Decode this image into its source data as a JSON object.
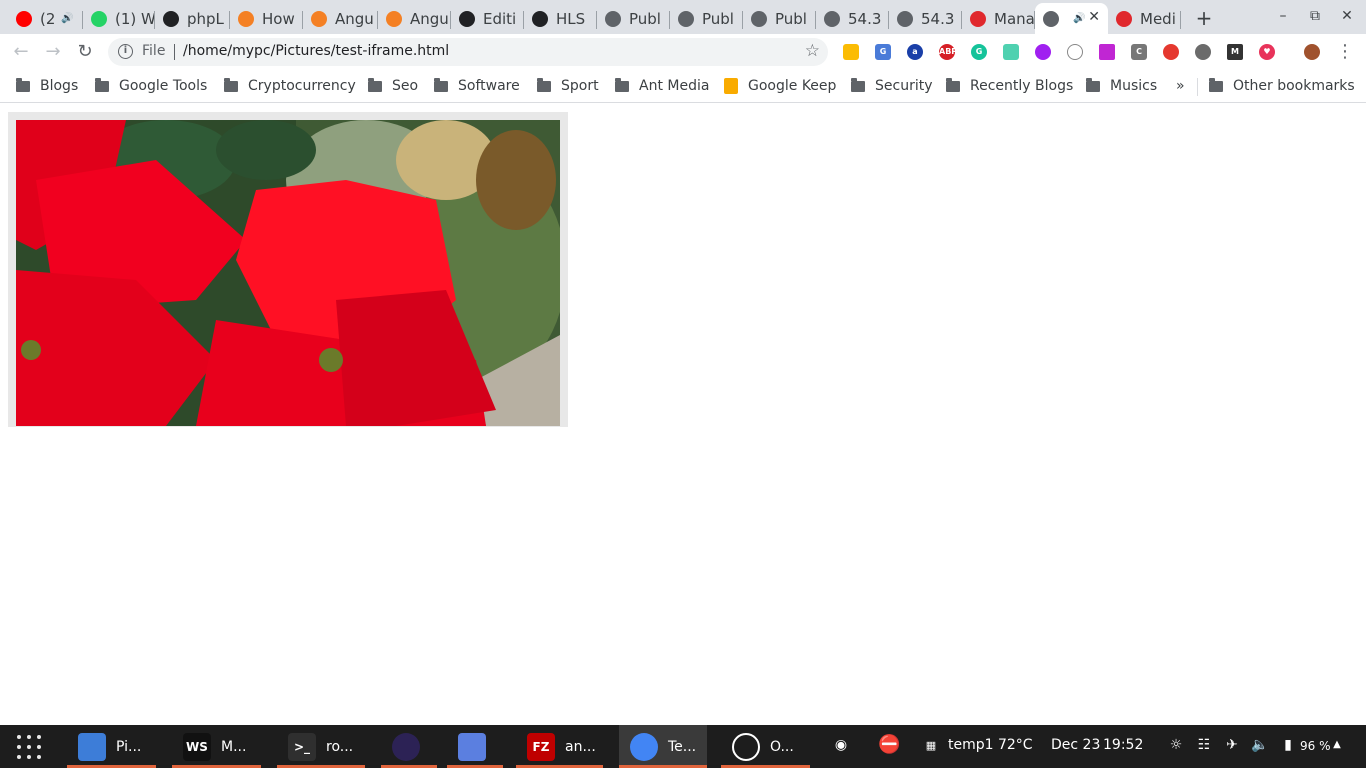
{
  "tabs": [
    {
      "title": "(2",
      "icon": "youtube-icon",
      "color": "#ff0000",
      "audio": true
    },
    {
      "title": "(1) W",
      "icon": "whatsapp-icon",
      "color": "#25d366"
    },
    {
      "title": "phpL",
      "icon": "x-icon",
      "color": "#202124"
    },
    {
      "title": "How",
      "icon": "stackoverflow-icon",
      "color": "#f48024"
    },
    {
      "title": "Angu",
      "icon": "stackoverflow-icon",
      "color": "#f48024"
    },
    {
      "title": "Angu",
      "icon": "stackoverflow-icon",
      "color": "#f48024"
    },
    {
      "title": "Editi",
      "icon": "github-icon",
      "color": "#202124"
    },
    {
      "title": "HLS",
      "icon": "github-icon",
      "color": "#202124"
    },
    {
      "title": "Publ",
      "icon": "globe-icon",
      "color": "#5f6368"
    },
    {
      "title": "Publ",
      "icon": "globe-icon",
      "color": "#5f6368"
    },
    {
      "title": "Publ",
      "icon": "globe-icon",
      "color": "#5f6368"
    },
    {
      "title": "54.3",
      "icon": "globe-icon",
      "color": "#5f6368"
    },
    {
      "title": "54.3",
      "icon": "globe-icon",
      "color": "#5f6368"
    },
    {
      "title": "Mana",
      "icon": "antmedia-icon",
      "color": "#e0282d"
    },
    {
      "title": "",
      "icon": "globe-icon",
      "color": "#5f6368",
      "active": true,
      "audio": true
    },
    {
      "title": "Medi",
      "icon": "antmedia-icon",
      "color": "#e0282d"
    }
  ],
  "toolbar": {
    "file_label": "File",
    "url": "/home/mypc/Pictures/test-iframe.html"
  },
  "bookmarks": [
    {
      "label": "Blogs"
    },
    {
      "label": "Google Tools"
    },
    {
      "label": "Cryptocurrency"
    },
    {
      "label": "Seo"
    },
    {
      "label": "Software"
    },
    {
      "label": "Sport"
    },
    {
      "label": "Ant Media"
    },
    {
      "label": "Google Keep",
      "keep": true
    },
    {
      "label": "Security"
    },
    {
      "label": "Recently Blogs"
    },
    {
      "label": "Musics"
    }
  ],
  "bookmarks_more": "»",
  "other_bookmarks": "Other bookmarks",
  "taskbar": {
    "apps": [
      {
        "label": "Pi...",
        "icon": "files-icon",
        "color": "#3d7dd8",
        "open": true
      },
      {
        "label": "M...",
        "icon": "webstorm-icon",
        "color": "#111111",
        "open": true,
        "text": "WS"
      },
      {
        "label": "ro...",
        "icon": "terminal-icon",
        "color": "#2f2f2f",
        "open": true,
        "text": ">_"
      },
      {
        "label": "",
        "icon": "eclipse-icon",
        "color": "#2c2255",
        "open": true
      },
      {
        "label": "",
        "icon": "screenshot-icon",
        "color": "#5b7fe0",
        "open": true
      },
      {
        "label": "an...",
        "icon": "filezilla-icon",
        "color": "#bf0000",
        "open": true,
        "text": "FZ"
      },
      {
        "label": "Te...",
        "icon": "chrome-icon",
        "color": "#4285f4",
        "open": true,
        "active": true
      },
      {
        "label": "O...",
        "icon": "obs-icon",
        "color": "#1d1d1d",
        "open": true
      }
    ],
    "temp": "temp1 72°C",
    "date": "Dec 23",
    "time": "19:52",
    "battery": "96 %"
  }
}
